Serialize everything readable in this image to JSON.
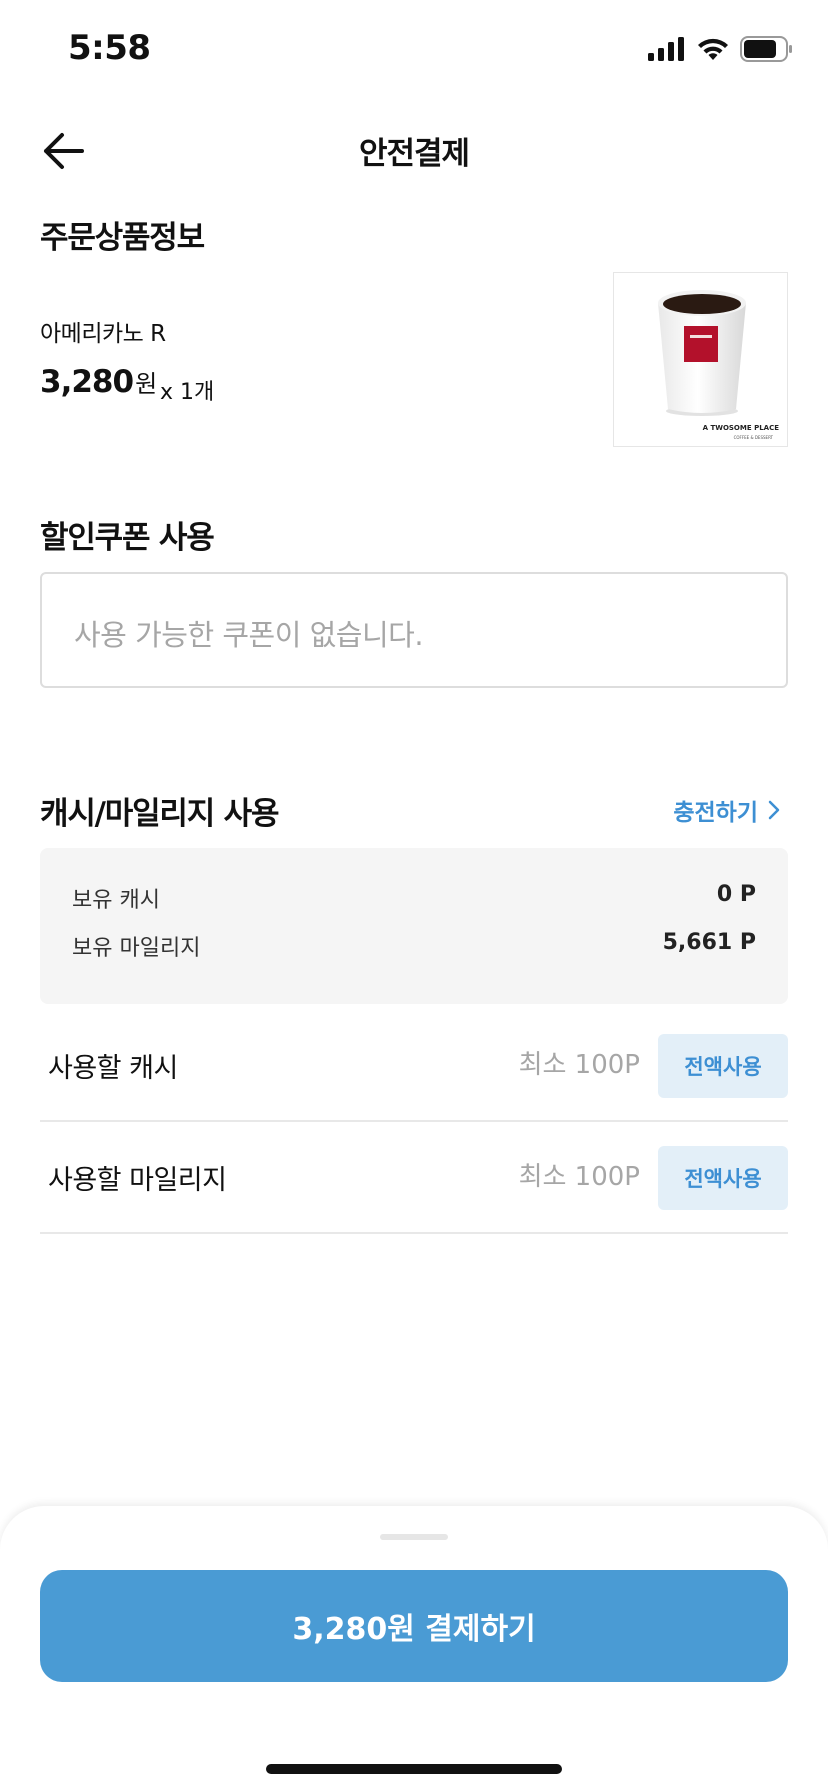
{
  "status_bar": {
    "time": "5:58"
  },
  "header": {
    "title": "안전결제"
  },
  "order": {
    "section_title": "주문상품정보",
    "product_name": "아메리카노 R",
    "price": "3,280",
    "price_unit": "원",
    "quantity": "x 1개",
    "thumb_brand": "A TWOSOME PLACE",
    "thumb_sub": "COFFEE & DESSERT"
  },
  "coupon": {
    "section_title": "할인쿠폰 사용",
    "placeholder": "사용 가능한 쿠폰이 없습니다."
  },
  "cash": {
    "section_title": "캐시/마일리지 사용",
    "charge_link": "충전하기",
    "balance": [
      {
        "label": "보유 캐시",
        "value": "0 P"
      },
      {
        "label": "보유 마일리지",
        "value": "5,661 P"
      }
    ],
    "use_rows": [
      {
        "label": "사용할 캐시",
        "placeholder": "최소 100P",
        "button": "전액사용"
      },
      {
        "label": "사용할 마일리지",
        "placeholder": "최소 100P",
        "button": "전액사용"
      }
    ]
  },
  "footer": {
    "pay_button": "3,280원 결제하기"
  },
  "colors": {
    "accent": "#4a9bd4",
    "link": "#3d8fd3",
    "chip_bg": "#e3eff8"
  }
}
